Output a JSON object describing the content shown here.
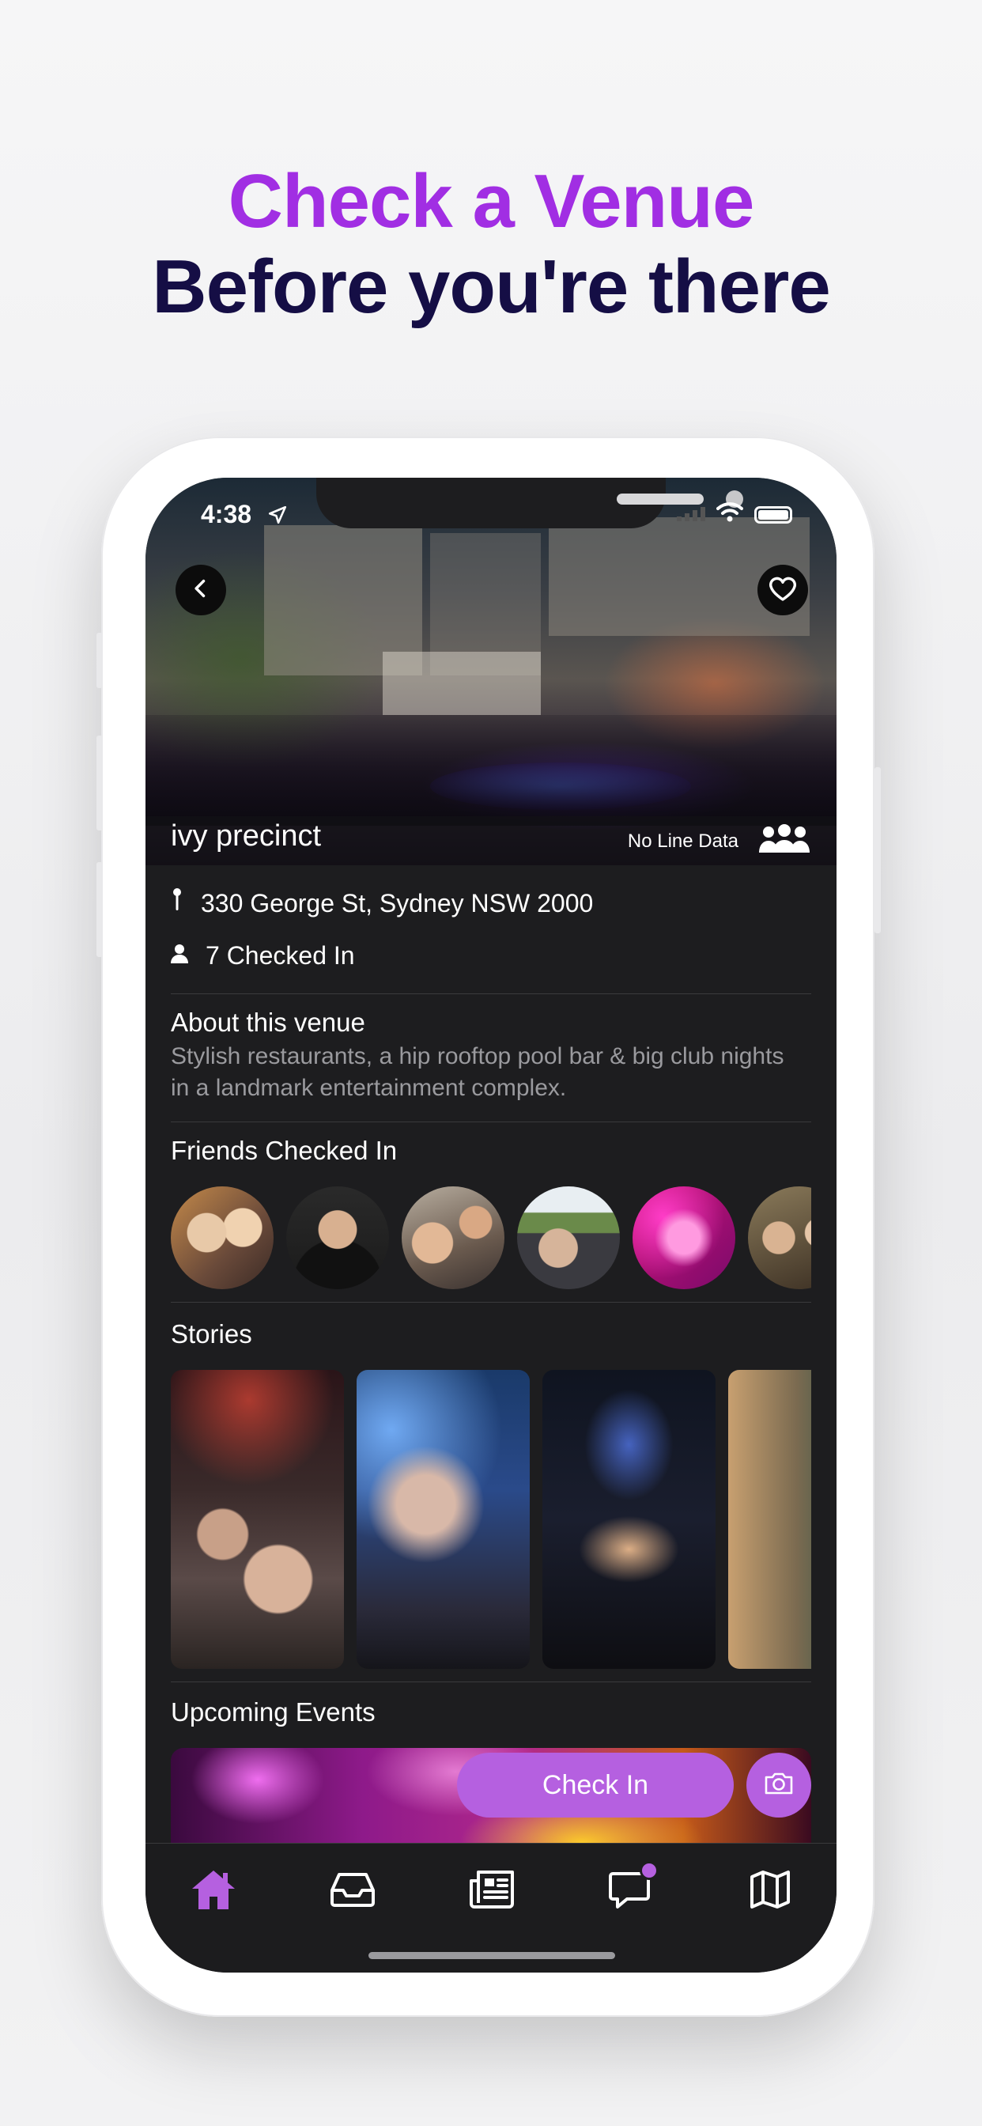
{
  "headline": {
    "line1": "Check a Venue",
    "line2": "Before you're there"
  },
  "status_bar": {
    "time": "4:38"
  },
  "venue": {
    "name": "ivy precinct",
    "line_status": "No Line Data",
    "address": "330 George St, Sydney NSW 2000",
    "checked_in": "7 Checked In"
  },
  "about": {
    "title": "About this venue",
    "text": "Stylish restaurants, a hip rooftop pool bar & big club nights in a landmark entertainment complex."
  },
  "friends": {
    "title": "Friends Checked In",
    "count_visible": 6
  },
  "stories": {
    "title": "Stories",
    "count_visible": 4
  },
  "events": {
    "title": "Upcoming Events"
  },
  "actions": {
    "check_in_label": "Check In"
  },
  "tabs": [
    "home-icon",
    "inbox-icon",
    "news-icon",
    "chat-icon",
    "map-icon"
  ],
  "colors": {
    "accent": "#b560e0",
    "headline_purple": "#a12ee3",
    "headline_navy": "#150e45",
    "screen_bg": "#1d1d1f",
    "secondary_text": "#9a9a9e"
  }
}
